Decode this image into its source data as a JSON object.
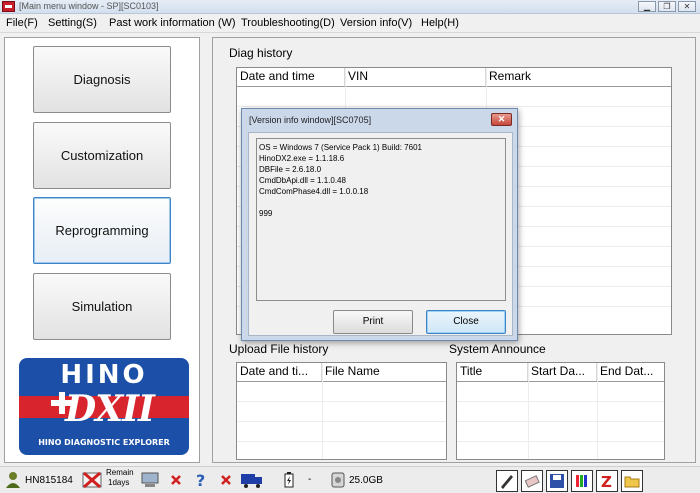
{
  "window": {
    "title": "[Main menu window - SP][SC0103]"
  },
  "menu": [
    {
      "label": "File(F)"
    },
    {
      "label": "Setting(S)"
    },
    {
      "label": "Past work information (W)"
    },
    {
      "label": "Troubleshooting(D)"
    },
    {
      "label": "Version info(V)"
    },
    {
      "label": "Help(H)"
    }
  ],
  "nav": [
    {
      "label": "Diagnosis"
    },
    {
      "label": "Customization"
    },
    {
      "label": "Reprogramming"
    },
    {
      "label": "Simulation"
    }
  ],
  "logo": {
    "word": "HINO",
    "mark": "DXII",
    "subtitle": "HINO DIAGNOSTIC EXPLORER"
  },
  "diag_history": {
    "label": "Diag history",
    "columns": [
      "Date and time",
      "VIN",
      "Remark"
    ]
  },
  "upload_history": {
    "label": "Upload File history",
    "columns": [
      "Date and ti...",
      "File Name"
    ]
  },
  "system_announce": {
    "label": "System Announce",
    "columns": [
      "Title",
      "Start Da...",
      "End Dat..."
    ]
  },
  "dialog": {
    "title": "[Version info window][SC0705]",
    "close_glyph": "✕",
    "lines": [
      "OS = Windows 7 (Service Pack 1) Build: 7601",
      "HinoDX2.exe = 1.1.18.6",
      "DBFile = 2.6.18.0",
      "CmdDbApi.dll = 1.1.0.48",
      "CmdComPhase4.dll = 1.0.0.18",
      "",
      "999"
    ],
    "print_label": "Print",
    "close_label": "Close"
  },
  "status": {
    "user": "HN815184",
    "remain": "Remain",
    "remain_days": "1days",
    "dash": "-",
    "disk": "25.0GB"
  },
  "colors": {
    "hino_blue": "#1b4fa8",
    "hino_red": "#d8242d",
    "focus_blue": "#3d83c6"
  }
}
